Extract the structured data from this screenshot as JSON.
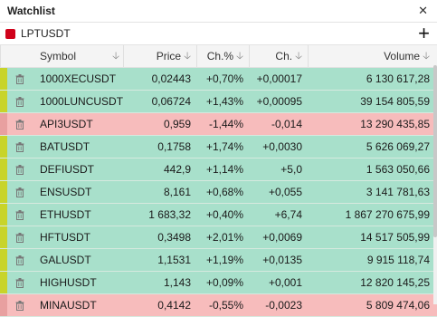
{
  "window": {
    "title": "Watchlist",
    "close_icon": "close-icon"
  },
  "list": {
    "name": "LPTUSDT",
    "color": "#d0021b",
    "add_icon": "plus-icon"
  },
  "columns": {
    "symbol": "Symbol",
    "price": "Price",
    "change_pct": "Ch.%",
    "change": "Ch.",
    "volume": "Volume"
  },
  "colors": {
    "up": "#a8e0cb",
    "down": "#f7bcbc",
    "marker_up": "#c8d42a",
    "marker_down": "#e8a0a0"
  },
  "rows": [
    {
      "symbol": "1000XECUSDT",
      "price": "0,02443",
      "change_pct": "+0,70%",
      "change": "+0,00017",
      "volume": "6 130 617,28",
      "direction": "up"
    },
    {
      "symbol": "1000LUNCUSDT",
      "price": "0,06724",
      "change_pct": "+1,43%",
      "change": "+0,00095",
      "volume": "39 154 805,59",
      "direction": "up"
    },
    {
      "symbol": "API3USDT",
      "price": "0,959",
      "change_pct": "-1,44%",
      "change": "-0,014",
      "volume": "13 290 435,85",
      "direction": "down"
    },
    {
      "symbol": "BATUSDT",
      "price": "0,1758",
      "change_pct": "+1,74%",
      "change": "+0,0030",
      "volume": "5 626 069,27",
      "direction": "up"
    },
    {
      "symbol": "DEFIUSDT",
      "price": "442,9",
      "change_pct": "+1,14%",
      "change": "+5,0",
      "volume": "1 563 050,66",
      "direction": "up"
    },
    {
      "symbol": "ENSUSDT",
      "price": "8,161",
      "change_pct": "+0,68%",
      "change": "+0,055",
      "volume": "3 141 781,63",
      "direction": "up"
    },
    {
      "symbol": "ETHUSDT",
      "price": "1 683,32",
      "change_pct": "+0,40%",
      "change": "+6,74",
      "volume": "1 867 270 675,99",
      "direction": "up"
    },
    {
      "symbol": "HFTUSDT",
      "price": "0,3498",
      "change_pct": "+2,01%",
      "change": "+0,0069",
      "volume": "14 517 505,99",
      "direction": "up"
    },
    {
      "symbol": "GALUSDT",
      "price": "1,1531",
      "change_pct": "+1,19%",
      "change": "+0,0135",
      "volume": "9 915 118,74",
      "direction": "up"
    },
    {
      "symbol": "HIGHUSDT",
      "price": "1,143",
      "change_pct": "+0,09%",
      "change": "+0,001",
      "volume": "12 820 145,25",
      "direction": "up"
    },
    {
      "symbol": "MINAUSDT",
      "price": "0,4142",
      "change_pct": "-0,55%",
      "change": "-0,0023",
      "volume": "5 809 474,06",
      "direction": "down"
    }
  ]
}
